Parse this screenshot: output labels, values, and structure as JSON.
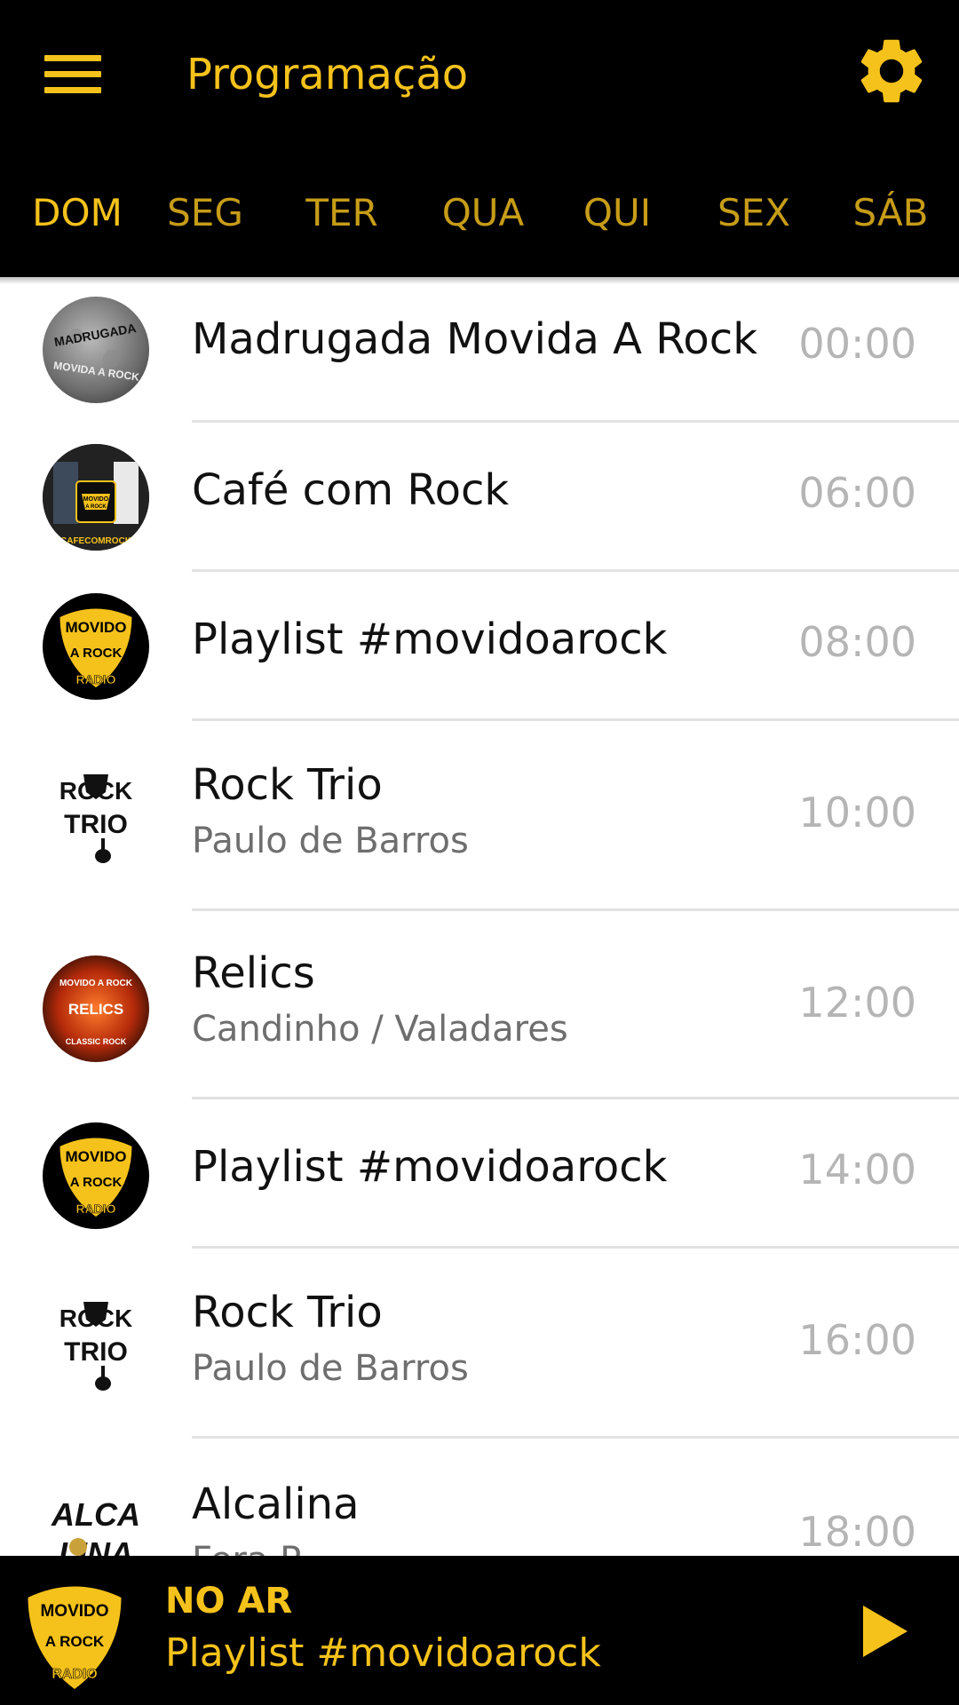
{
  "header": {
    "title": "Programação",
    "menu_icon": "hamburger-menu-icon",
    "settings_icon": "gear-icon",
    "accent_color": "#f5c21b",
    "background_color": "#000000"
  },
  "tabs": [
    {
      "label": "DOM",
      "active": true
    },
    {
      "label": "SEG",
      "active": false
    },
    {
      "label": "TER",
      "active": false
    },
    {
      "label": "QUA",
      "active": false
    },
    {
      "label": "QUI",
      "active": false
    },
    {
      "label": "SEX",
      "active": false
    },
    {
      "label": "SÁB",
      "active": false
    }
  ],
  "schedule": [
    {
      "name": "Madrugada Movida A Rock",
      "host": "",
      "time": "00:00",
      "logo_text": [
        "MADRUGADA",
        "MOVIDA A ROCK"
      ]
    },
    {
      "name": "Café com Rock",
      "host": "",
      "time": "06:00",
      "logo_text": [
        "MOVIDO",
        "A ROCK",
        "CAFECOMROCK"
      ]
    },
    {
      "name": "Playlist #movidoarock",
      "host": "",
      "time": "08:00",
      "logo_text": [
        "MOVIDO",
        "A ROCK",
        "RADIO"
      ]
    },
    {
      "name": "Rock Trio",
      "host": "Paulo de Barros",
      "time": "10:00",
      "logo_text": [
        "ROCK",
        "TRIO"
      ]
    },
    {
      "name": "Relics",
      "host": "Candinho / Valadares",
      "time": "12:00",
      "logo_text": [
        "MOVIDO A ROCK",
        "RELICS",
        "CLASSIC ROCK"
      ]
    },
    {
      "name": "Playlist #movidoarock",
      "host": "",
      "time": "14:00",
      "logo_text": [
        "MOVIDO",
        "A ROCK",
        "RADIO"
      ]
    },
    {
      "name": "Rock Trio",
      "host": "Paulo de Barros",
      "time": "16:00",
      "logo_text": [
        "ROCK",
        "TRIO"
      ]
    },
    {
      "name": "Alcalina",
      "host": "Fera P...",
      "time": "18:00",
      "logo_text": [
        "ALCA",
        "LINA"
      ]
    }
  ],
  "player": {
    "status": "NO AR",
    "now_playing": "Playlist #movidoarock",
    "logo_text": [
      "MOVIDO",
      "A ROCK",
      "RADIO"
    ],
    "play_icon": "play-icon"
  }
}
